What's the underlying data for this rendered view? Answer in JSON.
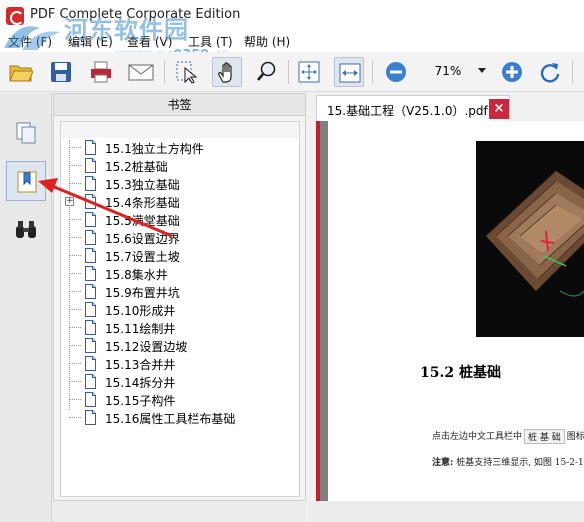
{
  "window": {
    "title": "PDF Complete Corporate Edition",
    "watermark_text": "河东软件园",
    "watermark_url": "www.pc0359.cn"
  },
  "menu": [
    {
      "label": "文件 (F)"
    },
    {
      "label": "编辑 (E)"
    },
    {
      "label": "查看 (V)"
    },
    {
      "label": "工具 (T)"
    },
    {
      "label": "帮助 (H)"
    }
  ],
  "toolbar": {
    "zoom_value": "71%",
    "buttons": [
      "open-folder-icon",
      "save-icon",
      "print-icon",
      "email-icon",
      "select-cursor-icon",
      "hand-tool-icon",
      "search-magnifier-icon",
      "fit-page-icon",
      "fit-width-icon",
      "zoom-out-icon",
      "zoom-in-icon",
      "rotate-icon"
    ]
  },
  "sidebar": {
    "buttons": [
      "pages-icon",
      "bookmarks-icon",
      "binoculars-icon"
    ],
    "selected": "bookmarks-icon"
  },
  "bookmarks": {
    "header": "书签",
    "items": [
      {
        "label": "15.1独立土方构件",
        "expandable": false
      },
      {
        "label": "15.2桩基础",
        "expandable": false
      },
      {
        "label": "15.3独立基础",
        "expandable": false
      },
      {
        "label": "15.4条形基础",
        "expandable": true
      },
      {
        "label": "15.5满堂基础",
        "expandable": false
      },
      {
        "label": "15.6设置边界",
        "expandable": false
      },
      {
        "label": "15.7设置土坡",
        "expandable": false
      },
      {
        "label": "15.8集水井",
        "expandable": false
      },
      {
        "label": "15.9布置井坑",
        "expandable": false
      },
      {
        "label": "15.10形成井",
        "expandable": false
      },
      {
        "label": "15.11绘制井",
        "expandable": false
      },
      {
        "label": "15.12设置边坡",
        "expandable": false
      },
      {
        "label": "15.13合并井",
        "expandable": false
      },
      {
        "label": "15.14拆分井",
        "expandable": false
      },
      {
        "label": "15.15子构件",
        "expandable": false
      },
      {
        "label": "15.16属性工具栏布基础",
        "expandable": false
      }
    ]
  },
  "document": {
    "tab_label": "15.基础工程（V25.1.0）.pdf",
    "close_label": "×",
    "page": {
      "heading": "15.2 桩基础",
      "line1_prefix": "点击左边中文工具栏中",
      "line1_button": "桩 基 础",
      "line1_suffix": "图标,",
      "line2_bold": "注意:",
      "line2_text": "桩基支持三维显示, 如图 15-2-1。"
    }
  },
  "colors": {
    "tab_close": "#c8283c",
    "doc_border": "#c21f2f",
    "annotation_arrow": "#e02020",
    "watermark": "#3c8cd2"
  }
}
